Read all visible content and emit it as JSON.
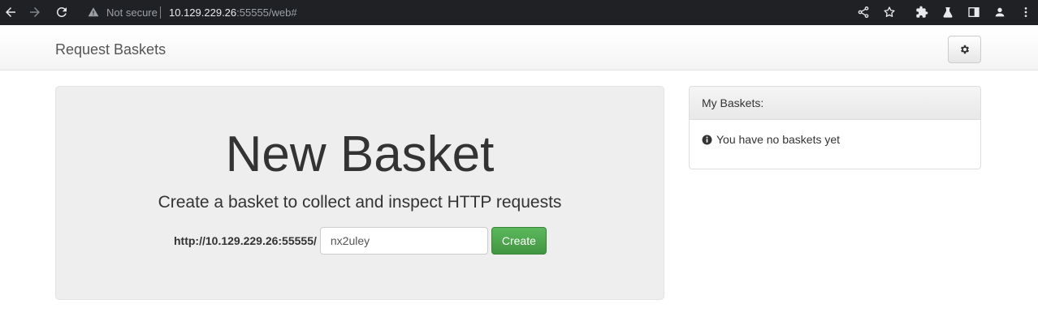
{
  "browser": {
    "security_label": "Not secure",
    "url_host": "10.129.229.26",
    "url_rest": ":55555/web#"
  },
  "navbar": {
    "brand": "Request Baskets"
  },
  "new_basket": {
    "title": "New Basket",
    "subtitle": "Create a basket to collect and inspect HTTP requests",
    "url_prefix": "http://10.129.229.26:55555/",
    "basket_name_value": "nx2uley",
    "create_label": "Create"
  },
  "my_baskets": {
    "heading": "My Baskets:",
    "empty_message": "You have no baskets yet"
  },
  "colors": {
    "chrome_bg": "#202124",
    "create_button": "#5cb85c",
    "jumbotron_bg": "#eeeeee"
  }
}
